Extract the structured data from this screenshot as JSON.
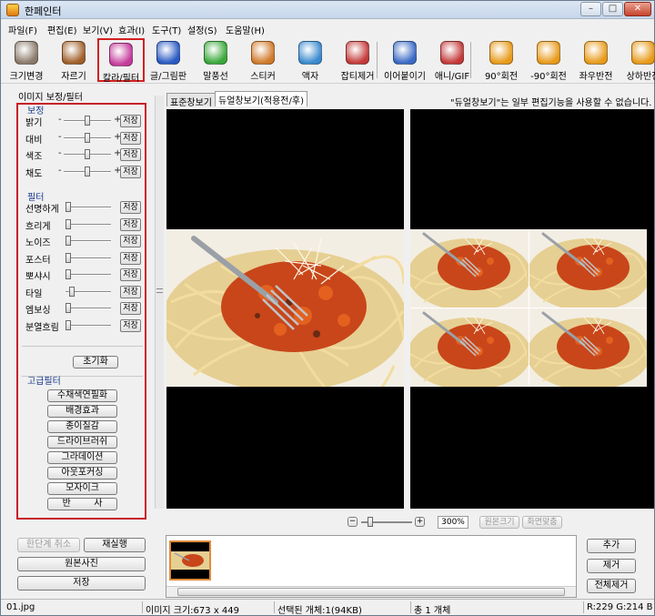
{
  "window": {
    "title": "한페인터",
    "min": "–",
    "max": "□",
    "close": "✕"
  },
  "menu": [
    "파일(F)",
    "편집(E)",
    "보기(V)",
    "효과(I)",
    "도구(T)",
    "설정(S)",
    "도움말(H)"
  ],
  "toolbar": [
    {
      "label": "크기변경",
      "icon": "resize-icon",
      "color": "#8a7a6a"
    },
    {
      "label": "자르기",
      "icon": "crop-icon",
      "color": "#a0602a"
    },
    {
      "label": "칼라/필터",
      "icon": "color-filter-icon",
      "color": "#c43a9a"
    },
    {
      "label": "글/그림판",
      "icon": "text-draw-icon",
      "color": "#2a5ac4"
    },
    {
      "label": "말풍선",
      "icon": "speech-bubble-icon",
      "color": "#3aa83a"
    },
    {
      "label": "스티커",
      "icon": "sticker-icon",
      "color": "#d07a2a"
    },
    {
      "label": "액자",
      "icon": "frame-icon",
      "color": "#3a8ad0"
    },
    {
      "label": "잡티제거",
      "icon": "blemish-remove-icon",
      "color": "#c43a3a"
    },
    {
      "label": "이어붙이기",
      "icon": "join-icon",
      "color": "#3a6ac4"
    },
    {
      "label": "애니/GIF",
      "icon": "gif-icon",
      "color": "#c43a3a"
    },
    {
      "label": "90°회전",
      "icon": "rotate-cw-icon",
      "color": "#e89a1a"
    },
    {
      "label": "-90°회전",
      "icon": "rotate-ccw-icon",
      "color": "#e89a1a"
    },
    {
      "label": "좌우반전",
      "icon": "flip-h-icon",
      "color": "#e89a1a"
    },
    {
      "label": "상하반전",
      "icon": "flip-v-icon",
      "color": "#e89a1a"
    }
  ],
  "left": {
    "title": "이미지 보정/필터",
    "section_adjust": "보정",
    "adjust": [
      {
        "label": "밝기",
        "value": 0.5
      },
      {
        "label": "대비",
        "value": 0.5
      },
      {
        "label": "색조",
        "value": 0.5
      },
      {
        "label": "채도",
        "value": 0.5
      }
    ],
    "section_filter": "필터",
    "filters": [
      {
        "label": "선명하게",
        "value": 0.0
      },
      {
        "label": "흐리게",
        "value": 0.0
      },
      {
        "label": "노이즈",
        "value": 0.0
      },
      {
        "label": "포스터",
        "value": 0.0
      },
      {
        "label": "뽀샤시",
        "value": 0.0
      },
      {
        "label": "타일",
        "value": 0.08
      },
      {
        "label": "엠보싱",
        "value": 0.0
      },
      {
        "label": "분열흐림",
        "value": 0.0
      }
    ],
    "minus": "-",
    "plus": "+",
    "save": "저장",
    "reset": "초기화",
    "section_advanced": "고급필터",
    "advanced": [
      "수채색연필화",
      "배경효과",
      "종이질감",
      "드라이브러쉬",
      "그라데이션",
      "아웃포커싱",
      "모자이크",
      "반        사"
    ]
  },
  "bottom_left": {
    "undo": "한단계 취소",
    "redo": "재실행",
    "original": "원본사진",
    "save": "저장"
  },
  "tabs": [
    "표준창보기",
    "듀얼창보기(적용전/후)"
  ],
  "notice": "\"듀얼창보기\"는 일부 편집기능을 사용할 수 없습니다.",
  "zoom": {
    "minus": "−",
    "plus": "+",
    "value": "300%",
    "actual": "원본크기",
    "fit": "화면맞춤"
  },
  "right_buttons": {
    "add": "추가",
    "remove": "제거",
    "remove_all": "전체제거"
  },
  "status": {
    "file": "01.jpg",
    "size": "이미지 크기:673 x 449",
    "selected": "선택된 개체:1(94KB)",
    "total": "총 1 개체",
    "color": "R:229 G:214 B"
  }
}
